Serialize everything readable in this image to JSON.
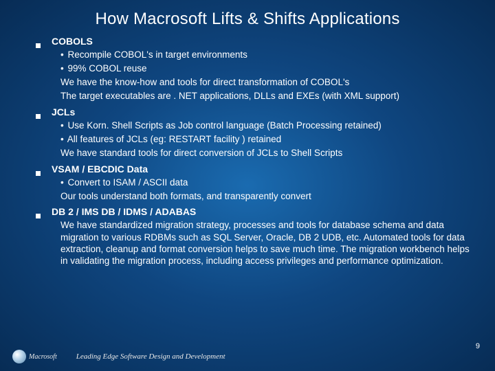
{
  "title": "How Macrosoft Lifts & Shifts Applications",
  "sections": [
    {
      "heading": "COBOLS",
      "bullets": [
        "Recompile COBOL's in target environments",
        "99% COBOL reuse"
      ],
      "lines": [
        "We have the know-how  and tools for direct transformation of COBOL's",
        "The target executables are . NET applications, DLLs and EXEs (with XML support)"
      ]
    },
    {
      "heading": "JCLs",
      "bullets": [
        "Use Korn. Shell Scripts as Job control language (Batch Processing retained)",
        "All features of JCLs (eg: RESTART facility ) retained"
      ],
      "lines": [
        "We have standard tools for direct conversion of JCLs to Shell Scripts"
      ]
    },
    {
      "heading": "VSAM / EBCDIC Data",
      "bullets": [
        "Convert to ISAM / ASCII data"
      ],
      "lines": [
        "Our tools understand both formats, and transparently convert"
      ]
    },
    {
      "heading": "DB 2 / IMS DB / IDMS / ADABAS",
      "bullets": [],
      "lines": [
        "We have standardized migration strategy, processes and tools for database schema and data migration to various RDBMs such as SQL Server, Oracle, DB 2 UDB, etc. Automated tools for data extraction, cleanup and format conversion helps to save much time. The migration workbench helps in validating the migration process, including access privileges and performance optimization."
      ]
    }
  ],
  "page_number": "9",
  "footer_brand": "Macrosoft",
  "footer_tagline": "Leading Edge Software Design and Development"
}
